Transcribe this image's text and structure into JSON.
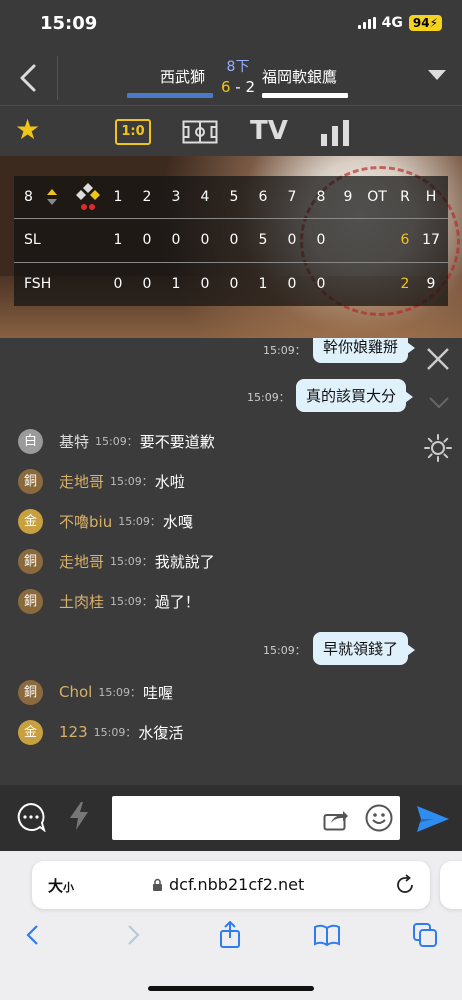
{
  "status": {
    "time": "15:09",
    "network": "4G",
    "battery": "94"
  },
  "header": {
    "team_home": "西武獅",
    "team_away": "福岡軟銀鷹",
    "inning": "8下",
    "score_home": "6",
    "score_sep": "-",
    "score_away": "2"
  },
  "toolbar": {
    "score_tab": "1:0",
    "tv_tab": "TV"
  },
  "scoreboard": {
    "current_inning": "8",
    "columns": [
      "1",
      "2",
      "3",
      "4",
      "5",
      "6",
      "7",
      "8",
      "9",
      "OT",
      "R",
      "H"
    ],
    "rows": [
      {
        "team": "SL",
        "innings": [
          "1",
          "0",
          "0",
          "0",
          "0",
          "5",
          "0",
          "0",
          ""
        ],
        "ot": "",
        "r": "6",
        "h": "17"
      },
      {
        "team": "FSH",
        "innings": [
          "0",
          "0",
          "1",
          "0",
          "0",
          "1",
          "0",
          "0",
          ""
        ],
        "ot": "",
        "r": "2",
        "h": "9"
      }
    ]
  },
  "chat": {
    "right_messages": [
      {
        "time": "15:09：",
        "text": "幹你娘雞掰"
      },
      {
        "time": "15:09：",
        "text": "真的該買大分"
      },
      {
        "time": "15:09：",
        "text": "早就領錢了"
      }
    ],
    "lines": [
      {
        "badge": "白",
        "badge_type": "white",
        "user": "基特",
        "time": "15:09：",
        "text": "要不要道歉"
      },
      {
        "badge": "銅",
        "badge_type": "bronze",
        "user": "走地哥",
        "time": "15:09：",
        "text": "水啦"
      },
      {
        "badge": "金",
        "badge_type": "gold",
        "user": "不嚕biu",
        "time": "15:09：",
        "text": "水嘎"
      },
      {
        "badge": "銅",
        "badge_type": "bronze",
        "user": "走地哥",
        "time": "15:09：",
        "text": "我就說了"
      },
      {
        "badge": "銅",
        "badge_type": "bronze",
        "user": "土肉桂",
        "time": "15:09：",
        "text": "過了！"
      },
      {
        "badge": "銅",
        "badge_type": "bronze",
        "user": "Chol",
        "time": "15:09：",
        "text": "哇喔"
      },
      {
        "badge": "金",
        "badge_type": "gold",
        "user": "123",
        "time": "15:09：",
        "text": "水復活"
      }
    ]
  },
  "input": {
    "placeholder": ""
  },
  "browser": {
    "text_size": "大",
    "text_size_small": "小",
    "url": "dcf.nbb21cf2.net"
  },
  "colors": {
    "accent_yellow": "#f0c419",
    "home_bar": "#4b78c9",
    "send_blue": "#2f8cf0"
  }
}
